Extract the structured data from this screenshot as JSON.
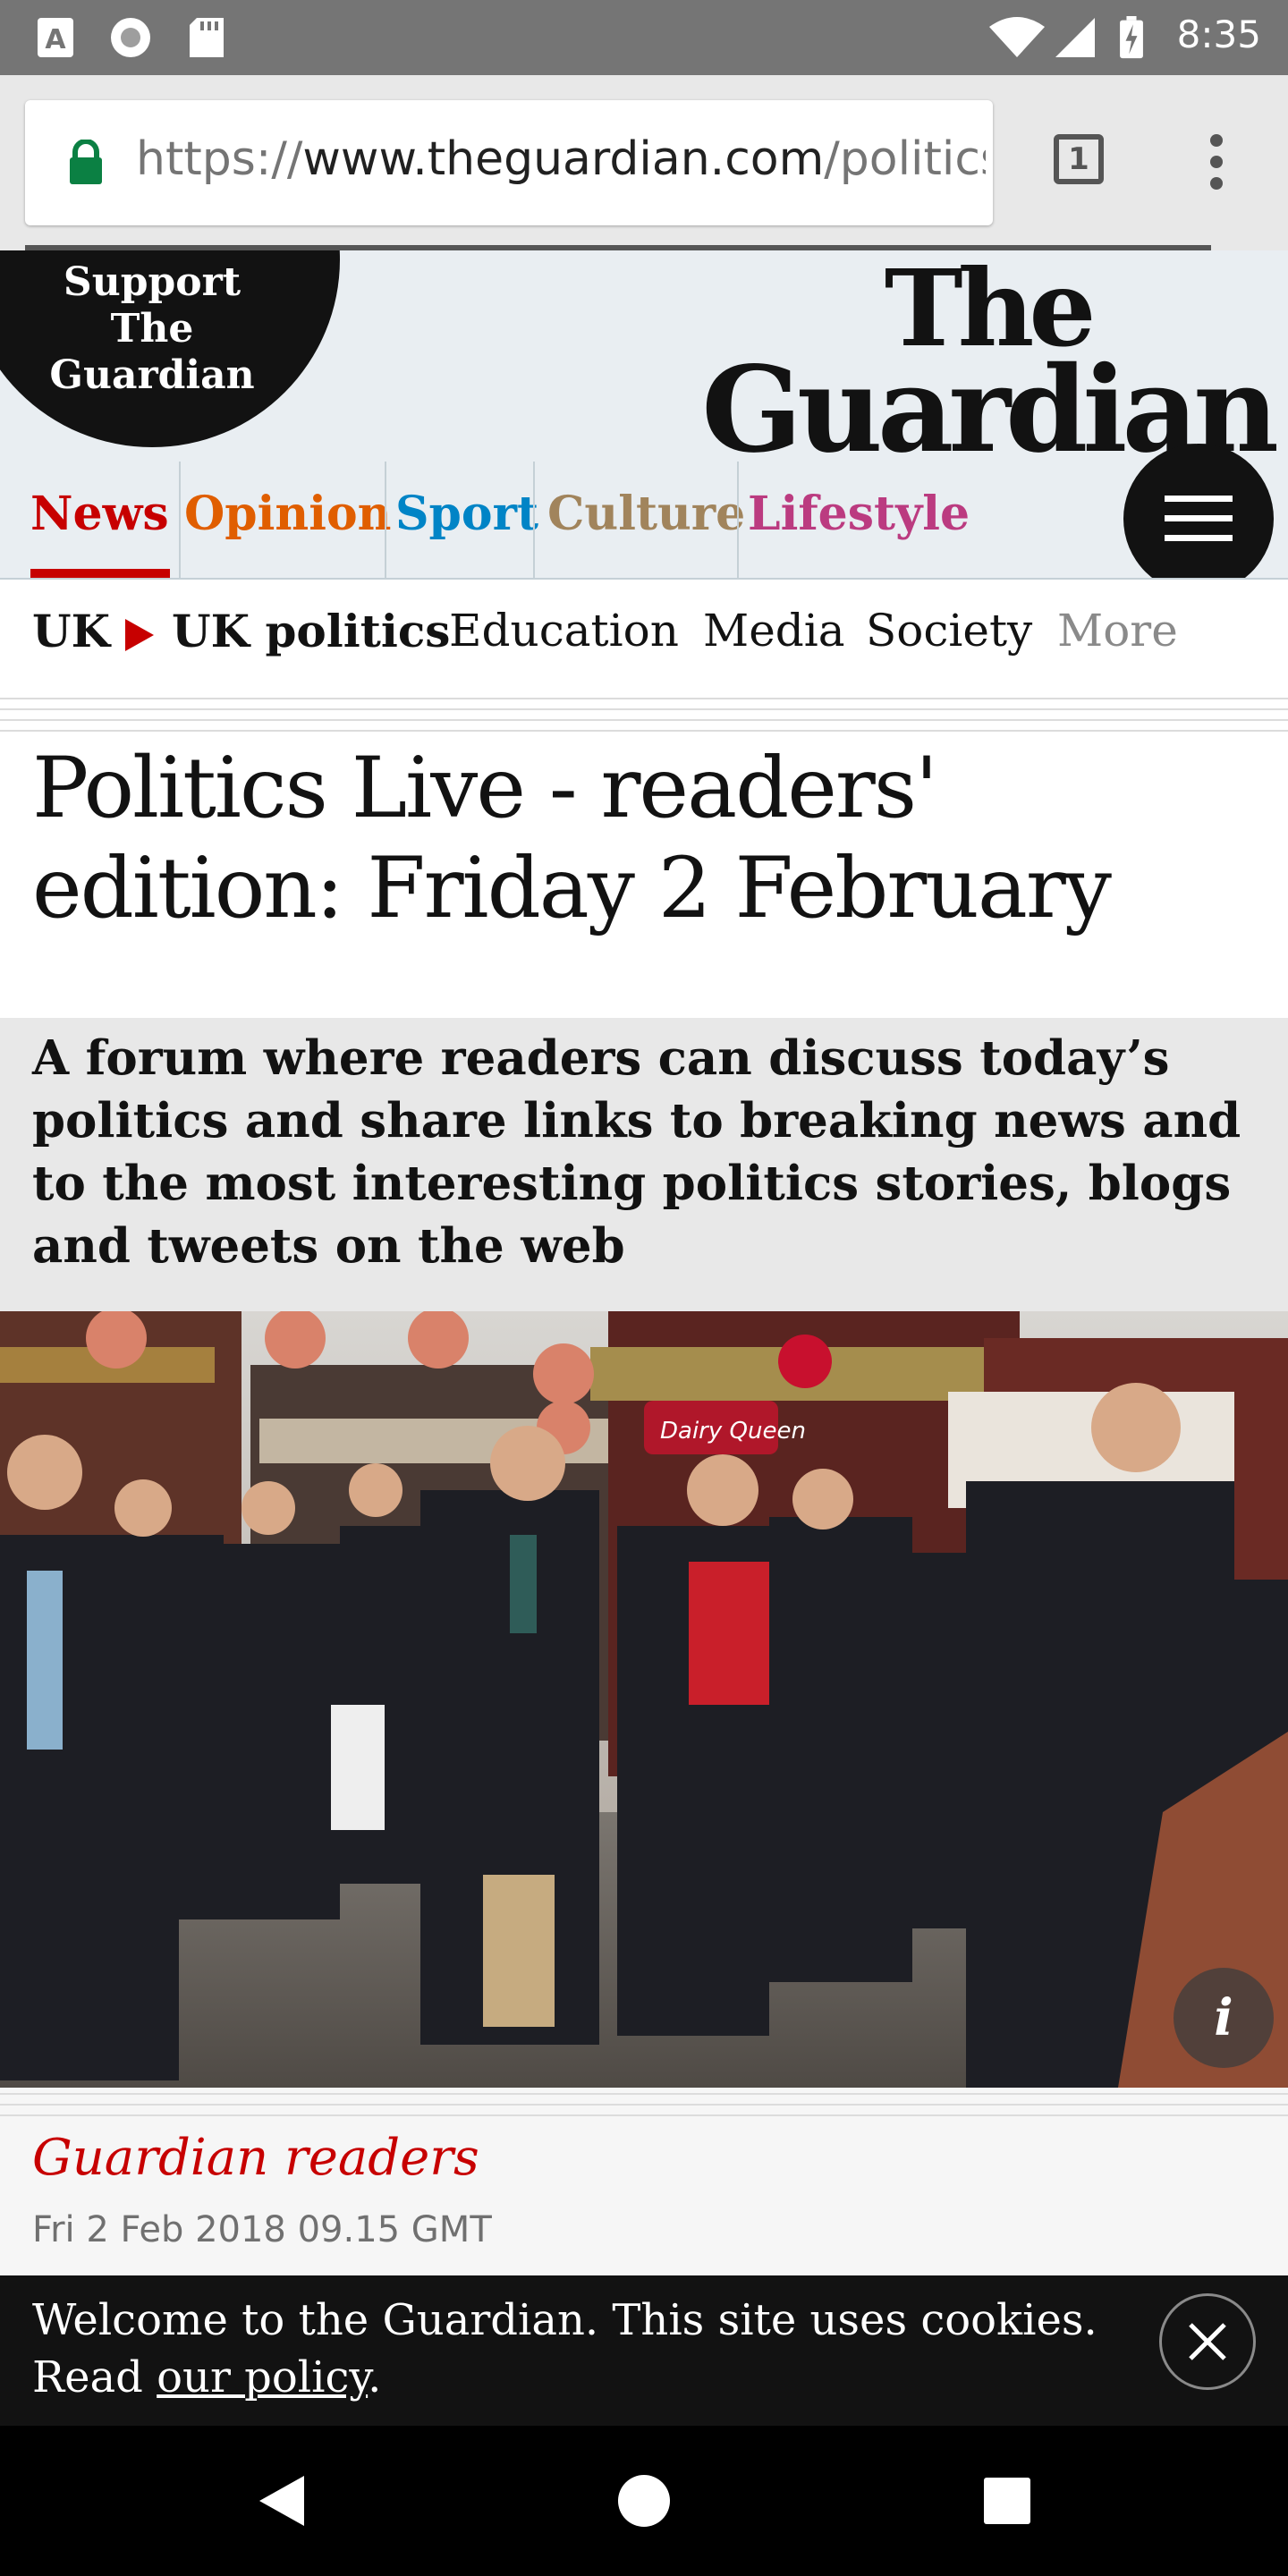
{
  "status_bar": {
    "time": "8:35"
  },
  "browser": {
    "url_scheme": "https://",
    "url_host": "www.theguardian.com",
    "url_path": "/politics",
    "tab_count": "1"
  },
  "header": {
    "support_label": "Support The Guardian",
    "logo_line1": "The",
    "logo_line2": "Guardian",
    "pillars": [
      {
        "label": "News",
        "color": "#c70000"
      },
      {
        "label": "Opinion",
        "color": "#e05e00"
      },
      {
        "label": "Sport",
        "color": "#0084c6"
      },
      {
        "label": "Culture",
        "color": "#a1845c"
      },
      {
        "label": "Lifestyle",
        "color": "#bb3b80"
      }
    ],
    "menu_icon": "hamburger-icon"
  },
  "subnav": {
    "section": "UK",
    "current": "UK politics",
    "items": [
      "Education",
      "Media",
      "Society"
    ],
    "more": "More"
  },
  "article": {
    "headline": "Politics Live - readers' edition: Friday 2 February",
    "standfirst": "A forum where readers can discuss today’s politics and share links to breaking news and to the most interesting politics stories, blogs and tweets on the web",
    "byline": "Guardian readers",
    "dateline": "Fri 2 Feb 2018 09.15 GMT",
    "photo_sign": "Dairy Queen",
    "info_label": "i"
  },
  "cookie": {
    "text": "Welcome to the Guardian. This site uses cookies. Read ",
    "link": "our policy",
    "end": "."
  },
  "colors": {
    "guardian_red": "#c70000",
    "header_bg": "#e9eef2",
    "standfirst_bg": "#e8e8e8"
  }
}
